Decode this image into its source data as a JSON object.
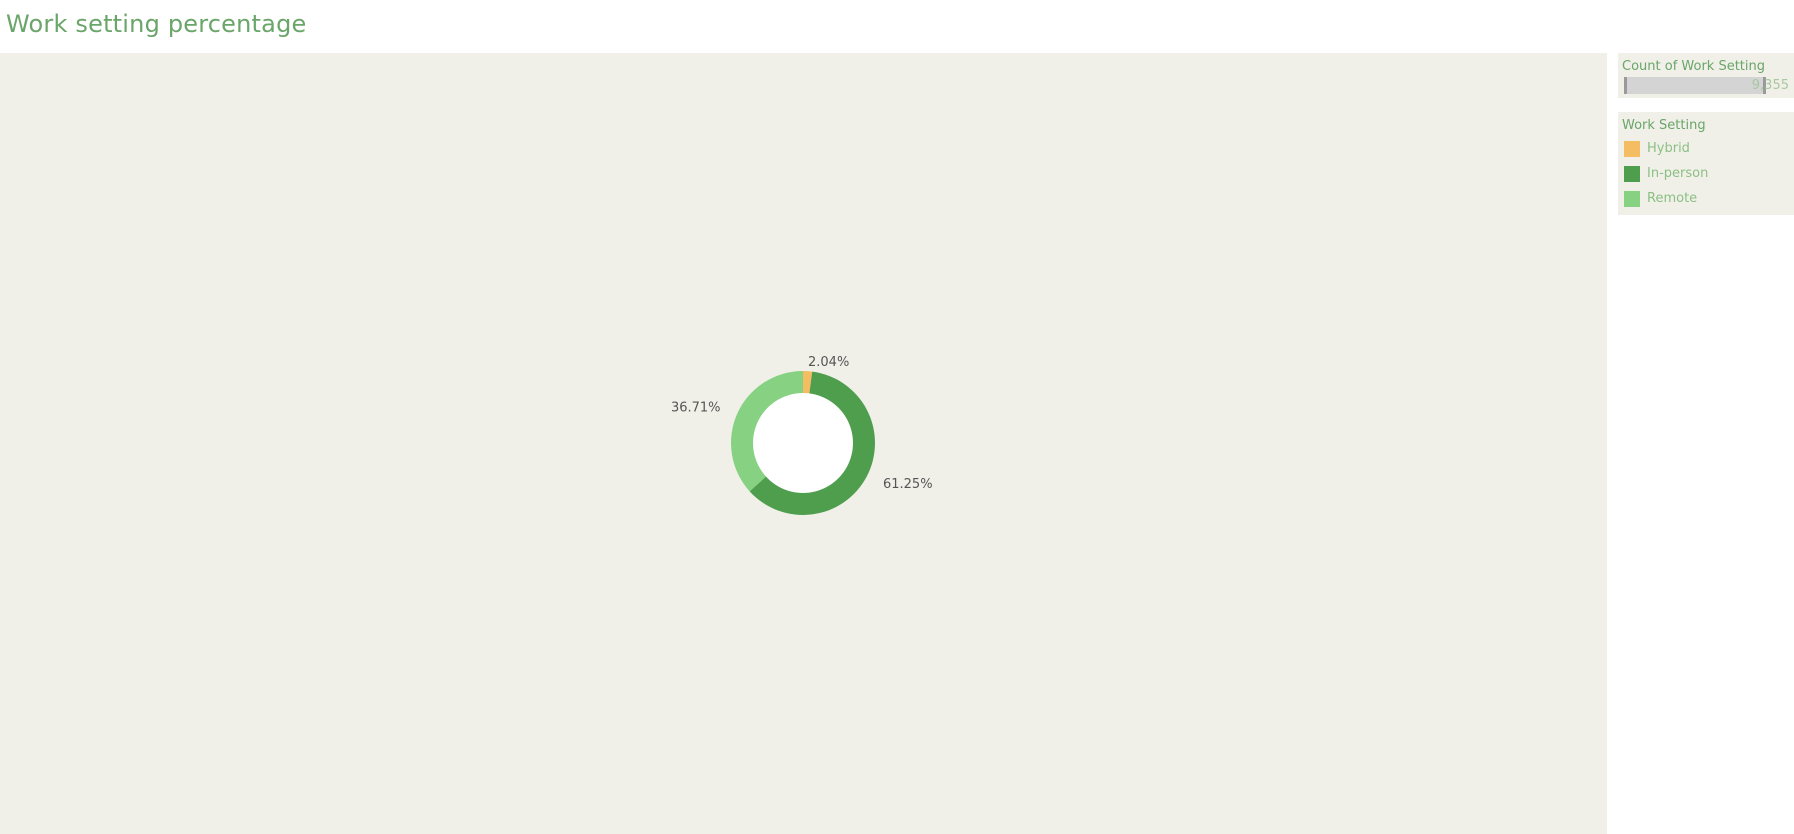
{
  "title": "Work setting percentage",
  "size_legend": {
    "title": "Count of Work Setting",
    "value_label": "9,355"
  },
  "color_legend": {
    "title": "Work Setting",
    "items": [
      {
        "label": "Hybrid",
        "color": "#f5bd62"
      },
      {
        "label": "In-person",
        "color": "#4e9e4e"
      },
      {
        "label": "Remote",
        "color": "#86d282"
      }
    ]
  },
  "chart_data": {
    "type": "pie",
    "style": "donut",
    "title": "Work setting percentage",
    "slices": [
      {
        "category": "Hybrid",
        "percent": 2.04,
        "label": "2.04%",
        "color": "#f5bd62"
      },
      {
        "category": "In-person",
        "percent": 61.25,
        "label": "61.25%",
        "color": "#4e9e4e"
      },
      {
        "category": "Remote",
        "percent": 36.71,
        "label": "36.71%",
        "color": "#86d282"
      }
    ],
    "total_count_label": "9,355",
    "legend_position": "right"
  }
}
